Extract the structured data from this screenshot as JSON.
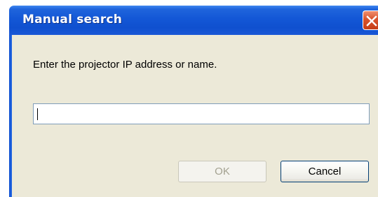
{
  "dialog": {
    "title": "Manual search",
    "prompt": "Enter the projector IP address or name.",
    "input": {
      "value": "",
      "placeholder": ""
    },
    "buttons": {
      "ok_label": "OK",
      "ok_enabled": false,
      "cancel_label": "Cancel"
    },
    "icons": {
      "close": "close-icon"
    },
    "colors": {
      "titlebar": "#1357d6",
      "client_background": "#ece9d8",
      "close_button": "#d8532c",
      "input_border": "#7f9db9"
    }
  }
}
